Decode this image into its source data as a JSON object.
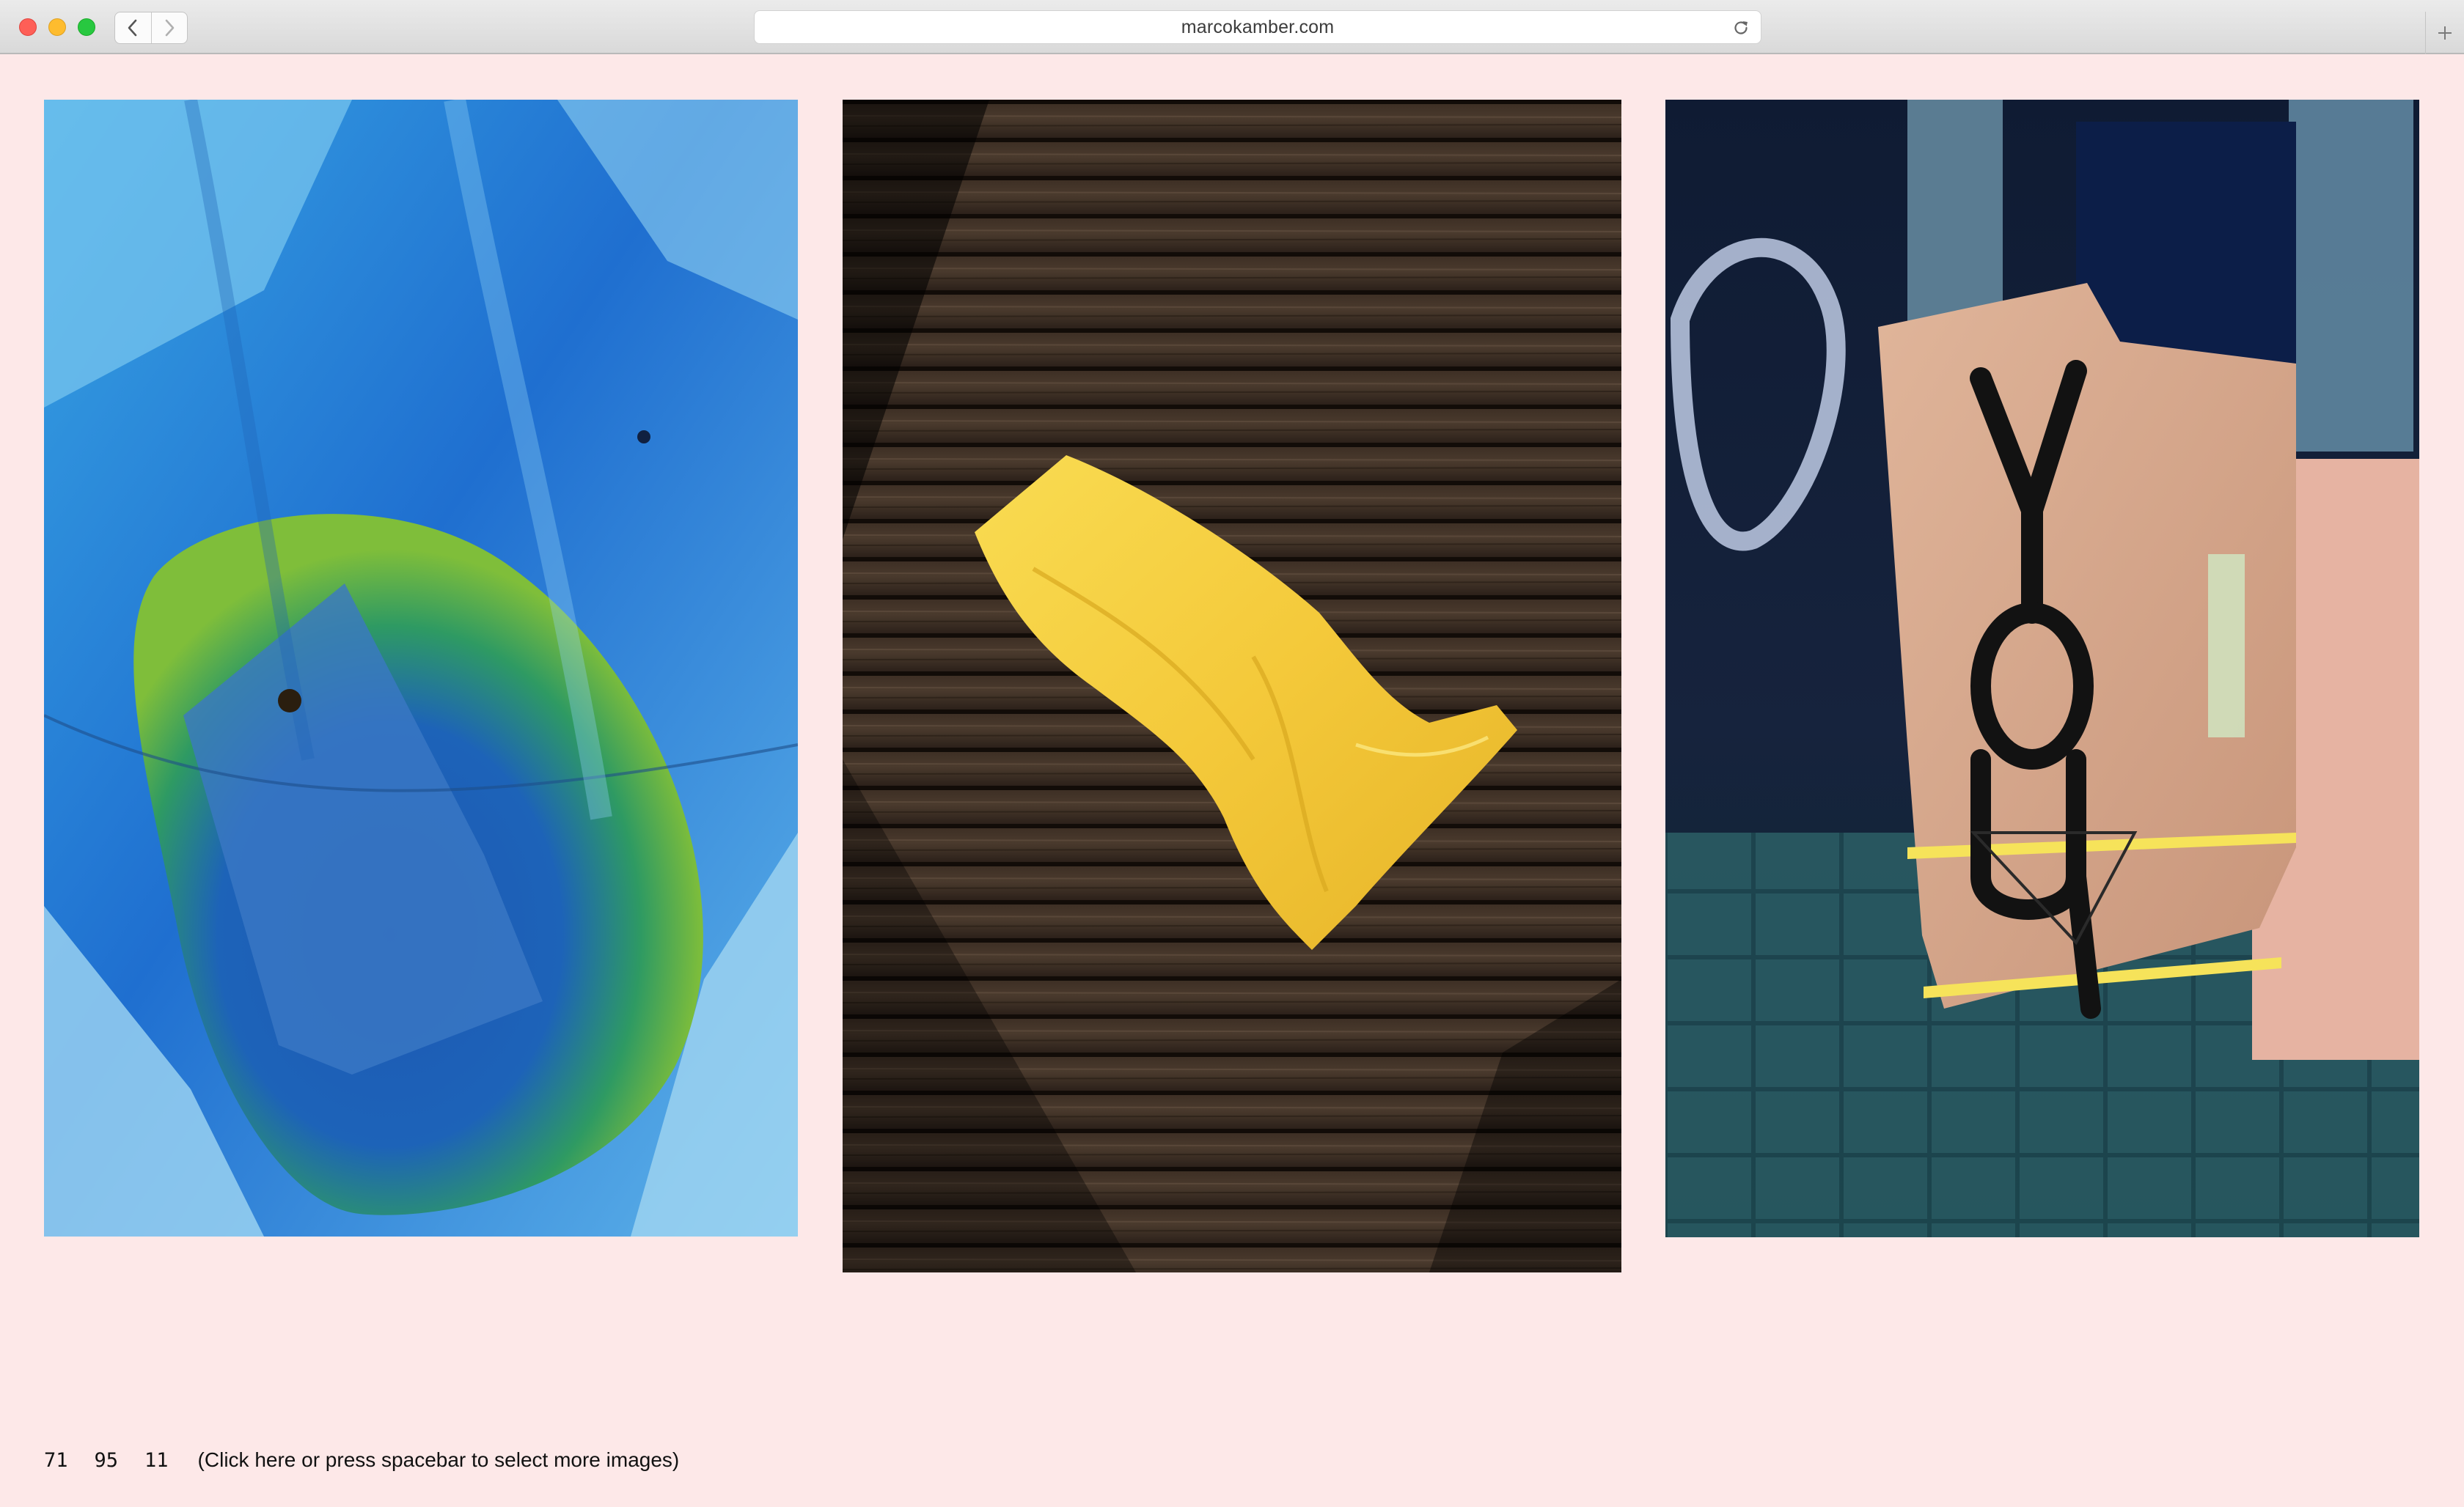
{
  "browser": {
    "url": "marcokamber.com",
    "icons": {
      "back": "chevron-left-icon",
      "forward": "chevron-right-icon",
      "reload": "reload-icon",
      "new_tab": "plus-icon"
    },
    "colors": {
      "close": "#fe5f57",
      "minimize": "#febc2e",
      "maximize": "#28c840"
    }
  },
  "gallery": {
    "background": "#fde8e8",
    "photos": [
      {
        "subject": "blue tarp with green water pool",
        "lettering": ""
      },
      {
        "subject": "yellow towel on dark wooden boardwalk",
        "lettering": ""
      },
      {
        "subject": "cardboard boxes with graffiti at night",
        "lettering": "YOU"
      }
    ]
  },
  "footer": {
    "counters": [
      "71",
      "95",
      "11"
    ],
    "select_more_label": "(Click here or press spacebar to select more images)"
  }
}
